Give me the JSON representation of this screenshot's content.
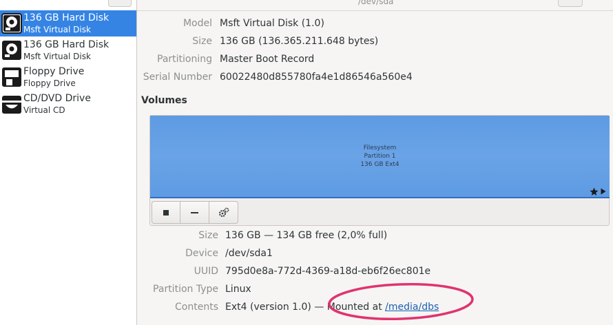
{
  "sidebar": {
    "drives": [
      {
        "title": "136 GB Hard Disk",
        "subtitle": "Msft Virtual Disk",
        "icon": "hard-disk-icon",
        "selected": true
      },
      {
        "title": "136 GB Hard Disk",
        "subtitle": "Msft Virtual Disk",
        "icon": "hard-disk-icon",
        "selected": false
      },
      {
        "title": "Floppy Drive",
        "subtitle": "Floppy Drive",
        "icon": "floppy-icon",
        "selected": false
      },
      {
        "title": "CD/DVD Drive",
        "subtitle": "Virtual CD",
        "icon": "optical-drive-icon",
        "selected": false
      }
    ]
  },
  "header": {
    "title": "/dev/sda"
  },
  "disk": {
    "model_label": "Model",
    "model_value": "Msft Virtual Disk (1.0)",
    "size_label": "Size",
    "size_value": "136 GB (136.365.211.648 bytes)",
    "partitioning_label": "Partitioning",
    "partitioning_value": "Master Boot Record",
    "serial_label": "Serial Number",
    "serial_value": "60022480d855780fa4e1d86546a560e4"
  },
  "volumes": {
    "heading": "Volumes",
    "partition": {
      "line1": "Filesystem",
      "line2": "Partition 1",
      "line3": "136 GB Ext4"
    },
    "toolbar": {
      "stop_icon": "stop-icon",
      "remove_icon": "minus-icon",
      "settings_icon": "gears-icon"
    }
  },
  "partition_details": {
    "size_label": "Size",
    "size_value": "136 GB — 134 GB free (2,0% full)",
    "device_label": "Device",
    "device_value": "/dev/sda1",
    "uuid_label": "UUID",
    "uuid_value": "795d0e8a-772d-4369-a18d-eb6f26ec801e",
    "type_label": "Partition Type",
    "type_value": "Linux",
    "contents_label": "Contents",
    "contents_prefix": "Ext4 (version 1.0) — Mounted at ",
    "contents_link": "/media/dbs"
  },
  "colors": {
    "selection": "#3584e4",
    "partition_fill": "#62a0ea",
    "annotation": "#e0336f",
    "link": "#1a5fb4"
  }
}
